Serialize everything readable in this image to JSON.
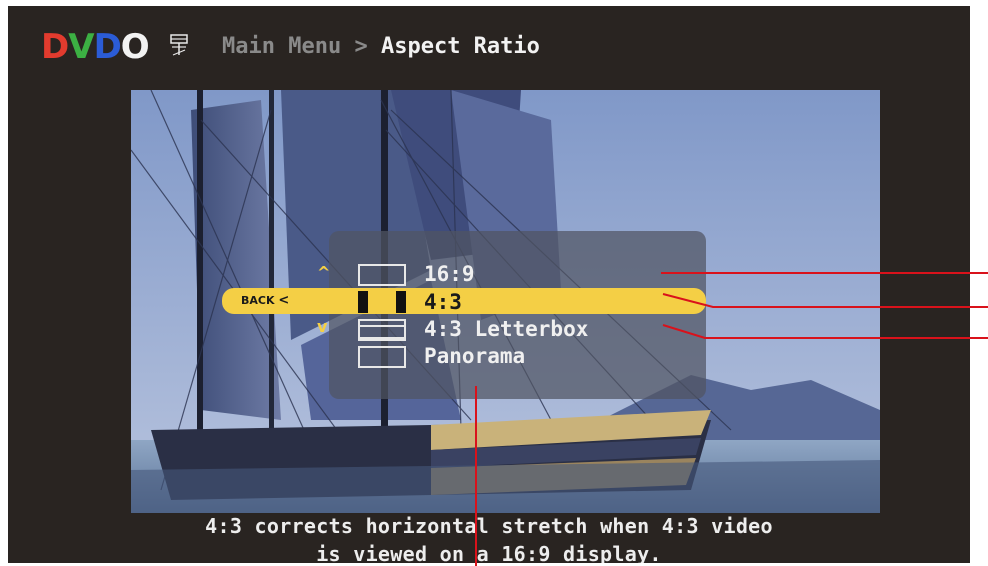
{
  "header": {
    "logo_letters": [
      "D",
      "V",
      "D",
      "O"
    ],
    "logo_colors": [
      "#e23b2e",
      "#3cb043",
      "#2b5cd6",
      "#f2f2f2"
    ],
    "breadcrumb_parent": "Main Menu",
    "breadcrumb_separator": " > ",
    "breadcrumb_current": "Aspect Ratio"
  },
  "menu": {
    "back_label": "BACK",
    "back_icon": "left-chevron-icon",
    "up_icon": "up-chevron-icon",
    "down_icon": "down-chevron-icon",
    "selected_index": 1,
    "accent_color": "#f4cf45",
    "items": [
      {
        "label": "16:9",
        "icon": "aspect-16-9-icon"
      },
      {
        "label": "4:3",
        "icon": "aspect-4-3-pillarbox-icon"
      },
      {
        "label": "4:3 Letterbox",
        "icon": "aspect-letterbox-icon"
      },
      {
        "label": "Panorama",
        "icon": "aspect-panorama-icon"
      }
    ]
  },
  "description": {
    "line1": "4:3 corrects horizontal stretch when 4:3 video",
    "line2": "is viewed on a 16:9 display."
  },
  "callout_color": "#d9121b"
}
